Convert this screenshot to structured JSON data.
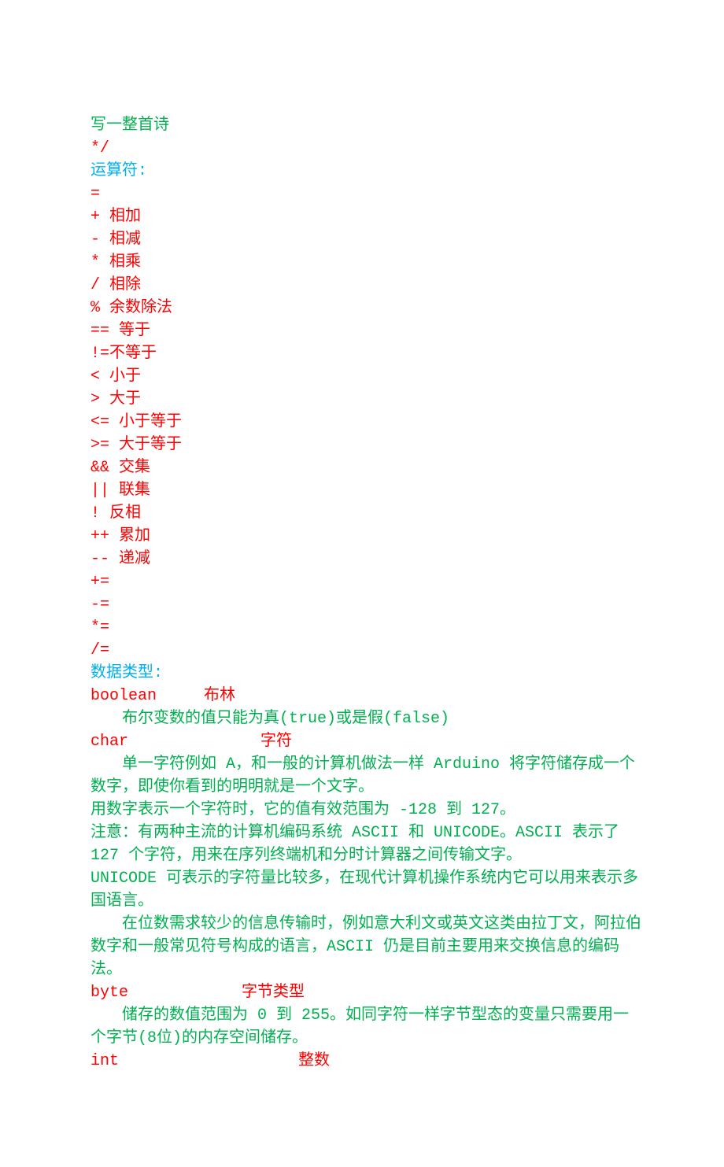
{
  "l01": "  写一整首诗",
  "l02": "*/",
  "l03": "运算符:",
  "l04": "=",
  "l05": "+ 相加",
  "l06": "- 相减",
  "l07": "* 相乘",
  "l08": "/ 相除",
  "l09": "% 余数除法",
  "l10": "==  等于",
  "l11": "!=不等于",
  "l12": "< 小于",
  "l13": "> 大于",
  "l14": "<= 小于等于",
  "l15": ">= 大于等于",
  "l16": "&&  交集",
  "l17": "||  联集",
  "l18": "!  反相",
  "l19": "++  累加",
  "l20": "--  递减",
  "l21": "+=",
  "l22": "-=",
  "l23": "*=",
  "l24": "/=",
  "l25": "数据类型:",
  "boolean_key": "boolean",
  "boolean_label": "布林",
  "l27": "布尔变数的值只能为真(true)或是假(false)",
  "char_key": "char",
  "char_label": "字符",
  "l29": "单一字符例如 A，和一般的计算机做法一样 Arduino 将字符储存成一个数字，即使你看到的明明就是一个文字。",
  "l30": "用数字表示一个字符时，它的值有效范围为 -128 到 127。",
  "l31": "注意：有两种主流的计算机编码系统 ASCII 和 UNICODE。ASCII 表示了 127 个字符，用来在序列终端机和分时计算器之间传输文字。",
  "l32": "UNICODE 可表示的字符量比较多，在现代计算机操作系统内它可以用来表示多国语言。",
  "l33": "在位数需求较少的信息传输时，例如意大利文或英文这类由拉丁文，阿拉伯数字和一般常见符号构成的语言，ASCII 仍是目前主要用来交换信息的编码法。",
  "byte_key": "byte",
  "byte_label": "字节类型",
  "l35": "储存的数值范围为 0 到 255。如同字符一样字节型态的变量只需要用一个字节(8位)的内存空间储存。",
  "int_key": "int",
  "int_label": "整数"
}
